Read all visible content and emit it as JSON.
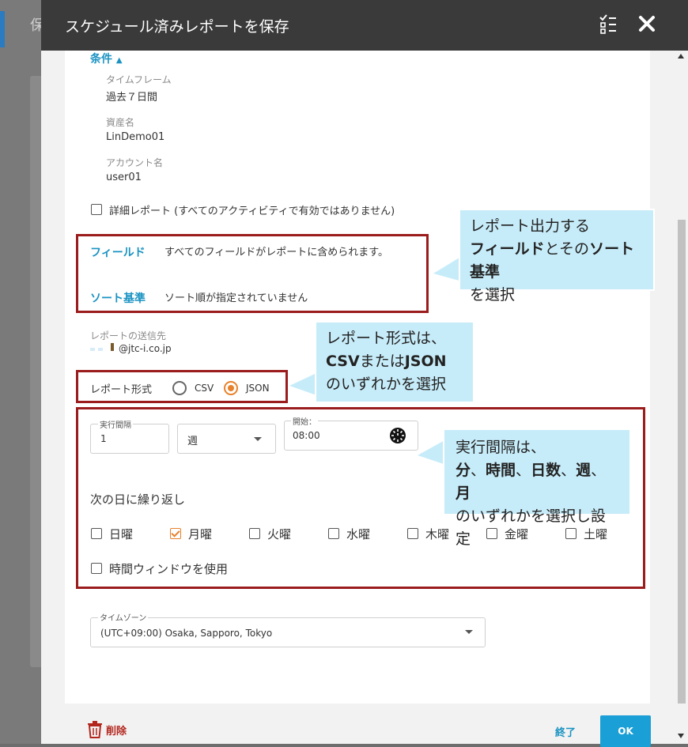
{
  "dialog": {
    "title": "スケジュール済みレポートを保存",
    "background_title": "保"
  },
  "conditions": {
    "toggle_label": "条件",
    "items": [
      {
        "label": "タイムフレーム",
        "value": "過去７日間"
      },
      {
        "label": "資産名",
        "value": "LinDemo01"
      },
      {
        "label": "アカウント名",
        "value": "user01"
      }
    ]
  },
  "detail_report": {
    "label": "詳細レポート (すべてのアクティビティで有効ではありません)",
    "checked": false
  },
  "fields": {
    "label": "フィールド",
    "value": "すべてのフィールドがレポートに含められます。",
    "sort_label": "ソート基準",
    "sort_value": "ソート順が指定されていません"
  },
  "recipient": {
    "label": "レポートの送信先",
    "email_suffix": "@jtc-i.co.jp"
  },
  "format": {
    "label": "レポート形式",
    "options": [
      "CSV",
      "JSON"
    ],
    "selected": "JSON"
  },
  "schedule": {
    "interval_label": "実行間隔",
    "interval_value": "1",
    "unit_value": "週",
    "start_label": "開始：",
    "start_value": "08:00",
    "repeat_label": "次の日に繰り返し",
    "days": [
      {
        "label": "日曜",
        "checked": false
      },
      {
        "label": "月曜",
        "checked": true
      },
      {
        "label": "火曜",
        "checked": false
      },
      {
        "label": "水曜",
        "checked": false
      },
      {
        "label": "木曜",
        "checked": false
      },
      {
        "label": "金曜",
        "checked": false
      },
      {
        "label": "土曜",
        "checked": false
      }
    ],
    "time_window_label": "時間ウィンドウを使用"
  },
  "timezone": {
    "label": "タイムゾーン",
    "value": "(UTC+09:00) Osaka, Sapporo, Tokyo"
  },
  "footer": {
    "delete_label": "削除",
    "finish_label": "終了",
    "ok_label": "OK"
  },
  "callouts": {
    "fields": {
      "l1": "レポート出力する",
      "b1": "フィールド",
      "t1": "とその",
      "b2": "ソート基準",
      "l3": "を選択"
    },
    "format": {
      "l1": "レポート形式は、",
      "b1": "CSV",
      "t1": "または",
      "b2": "JSON",
      "l3": "のいずれかを選択"
    },
    "interval": {
      "l1": "実行間隔は、",
      "b1": "分",
      "s1": "、",
      "b2": "時間",
      "s2": "、",
      "b3": "日数",
      "s3": "、",
      "b4": "週",
      "s4": "、",
      "b5": "月",
      "l3": "のいずれかを選択し設定"
    }
  },
  "colors": {
    "accent_orange": "#e8812b",
    "link_blue": "#1a93c2",
    "annotation_red": "#9b1c1c",
    "callout_bg": "#c7ecf9",
    "ok_button": "#1a9fd6"
  }
}
